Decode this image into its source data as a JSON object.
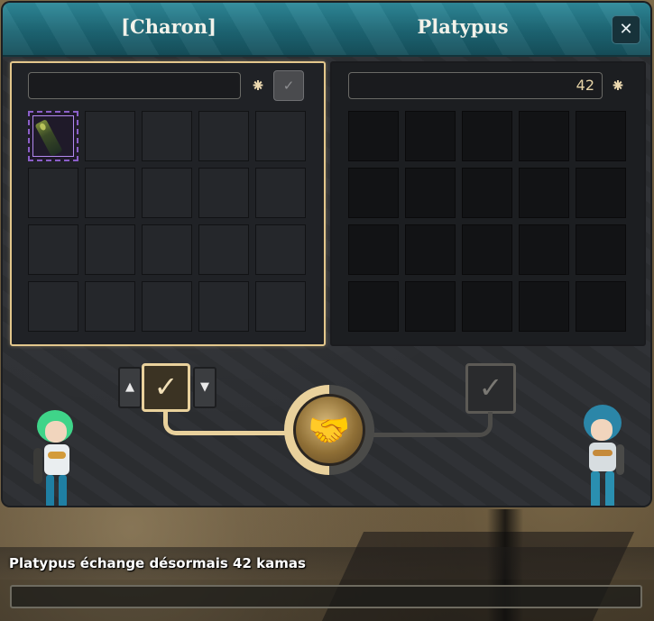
{
  "window": {
    "left_title": "[Charon]",
    "right_title": "Platypus",
    "close_icon": "close-icon",
    "close_glyph": "✕"
  },
  "mine": {
    "kamas_value": "",
    "kamas_icon_glyph": "⁕",
    "confirm_glyph": "✓",
    "slots_total": 20,
    "items": [
      {
        "slot": 0,
        "icon": "weapon-icon",
        "rarity_color": "#8b5fc9"
      }
    ]
  },
  "theirs": {
    "kamas_value": "42",
    "kamas_icon_glyph": "⁕",
    "slots_total": 20,
    "items": []
  },
  "exchange": {
    "up_glyph": "▲",
    "down_glyph": "▼",
    "my_check_glyph": "✓",
    "their_check_glyph": "✓",
    "handshake_glyph": "🤝",
    "my_ready": true,
    "their_ready": false
  },
  "chat": {
    "message": "Platypus échange désormais 42 kamas",
    "input_value": ""
  },
  "colors": {
    "accent_gold": "#e9d19c",
    "header_teal": "#1d6674",
    "item_rarity_purple": "#8b5fc9"
  }
}
